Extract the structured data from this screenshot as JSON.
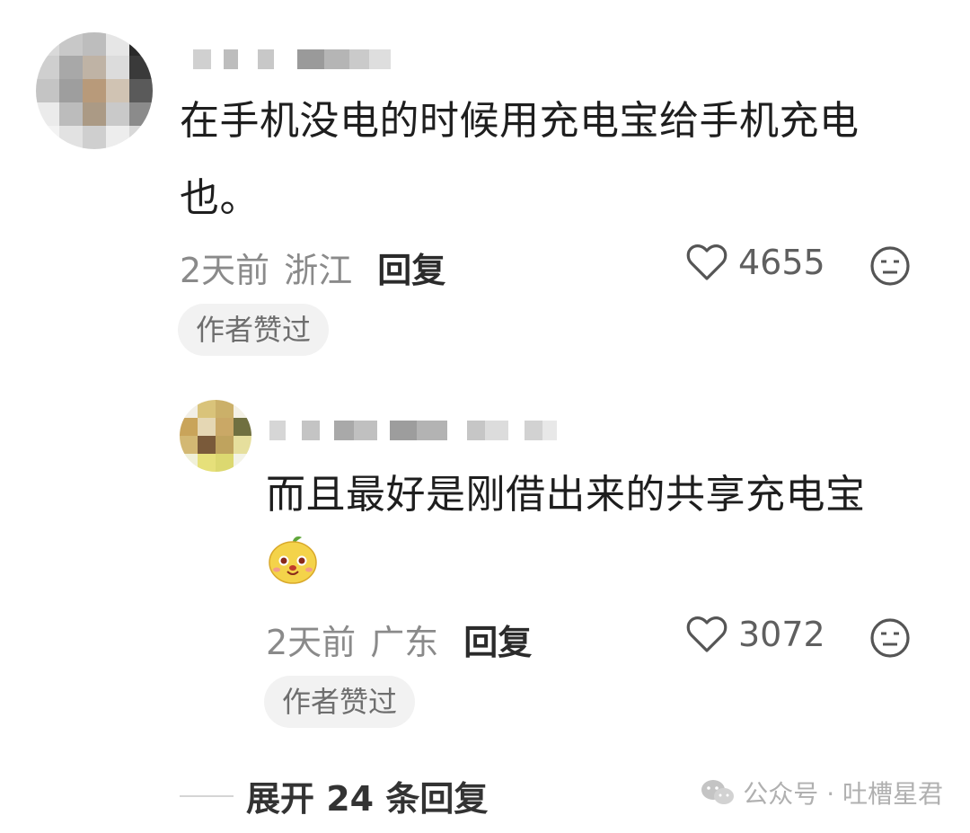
{
  "comments": [
    {
      "text": "在手机没电的时候用充电宝给手机充电也。",
      "time": "2天前",
      "location": "浙江",
      "reply_label": "回复",
      "likes": "4655",
      "badge": "作者赞过"
    },
    {
      "text": "而且最好是刚借出来的共享充电宝",
      "time": "2天前",
      "location": "广东",
      "reply_label": "回复",
      "likes": "3072",
      "badge": "作者赞过",
      "emoji": "cute-face-emoji"
    }
  ],
  "expand_label": "展开 24 条回复",
  "watermark": "公众号 · 吐槽星君",
  "colors": {
    "text": "#1e1e1e",
    "meta": "#8a8a8a",
    "badge_bg": "#f2f2f2",
    "like_icon": "#555555"
  }
}
